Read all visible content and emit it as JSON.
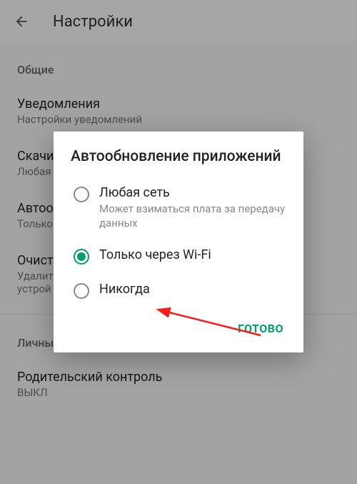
{
  "header": {
    "title": "Настройки"
  },
  "sections": {
    "general": {
      "label": "Общие"
    },
    "personal": {
      "label": "Личны"
    }
  },
  "items": {
    "notifications": {
      "title": "Уведомления",
      "sub": "Настройки уведомлений"
    },
    "downloads": {
      "title": "Скачи",
      "sub": "Любая"
    },
    "autoupdate": {
      "title": "Автоо",
      "sub": "Только"
    },
    "history": {
      "title": "Очист",
      "sub": "Удалит\nустрой"
    },
    "parental": {
      "title": "Родительский контроль",
      "sub": "ВЫКЛ"
    }
  },
  "dialog": {
    "title": "Автообновление приложений",
    "options": {
      "any": {
        "label": "Любая сеть",
        "sub": "Может взиматься плата за передачу данных"
      },
      "wifi": {
        "label": "Только через Wi-Fi"
      },
      "never": {
        "label": "Никогда"
      }
    },
    "action": "ГОТОВО"
  }
}
